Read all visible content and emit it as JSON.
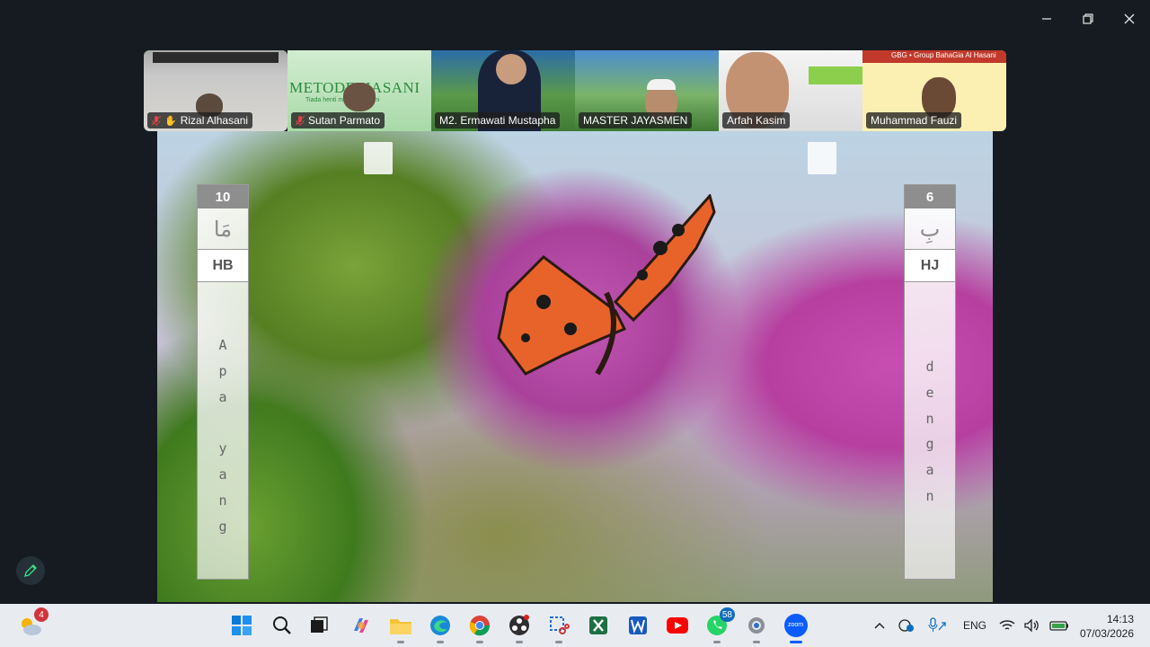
{
  "window_controls": {
    "minimize": "minimize-icon",
    "restore": "restore-icon",
    "close": "close-icon"
  },
  "participants": [
    {
      "name": "Rizal Alhasani",
      "muted": true,
      "hand_raised": true,
      "active": true
    },
    {
      "name": "Sutan Parmato",
      "muted": true,
      "tile_text": "METODE HASANI",
      "tile_subtext": "Tiada henti m...ungan Ilahi"
    },
    {
      "name": "M2. Ermawati Mustapha",
      "muted": false
    },
    {
      "name": "MASTER JAYASMEN",
      "muted": false
    },
    {
      "name": "Arfah Kasim",
      "muted": false
    },
    {
      "name": "Muhammad Fauzi",
      "muted": false,
      "tile_header": "GBG • Group BahaGia Al Hasani"
    }
  ],
  "lesson": {
    "left": {
      "number": "10",
      "arabic": "مَا",
      "code": "HB",
      "word": [
        "A",
        "p",
        "a",
        "",
        "y",
        "a",
        "n",
        "g"
      ]
    },
    "right": {
      "number": "6",
      "arabic": "بِ",
      "code": "HJ",
      "word": [
        "d",
        "e",
        "n",
        "g",
        "a",
        "n"
      ]
    }
  },
  "taskbar": {
    "weather_badge": "4",
    "whatsapp_badge": "58",
    "icons": [
      "weather-icon",
      "start-icon",
      "search-icon",
      "task-view-icon",
      "copilot-icon",
      "file-explorer-icon",
      "edge-icon",
      "chrome-icon",
      "obs-icon",
      "snipping-tool-icon",
      "excel-icon",
      "word-icon",
      "youtube-icon",
      "whatsapp-icon",
      "settings-icon",
      "zoom-icon"
    ],
    "zoom_label": "zoom",
    "language": "ENG",
    "time": "14:13",
    "date": "07/03/2026"
  }
}
